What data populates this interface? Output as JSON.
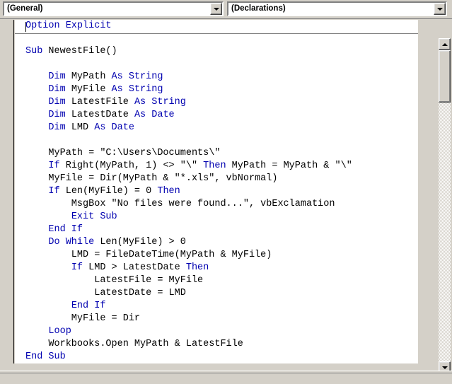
{
  "window": {
    "kind": "vba-code-editor"
  },
  "toolbar": {
    "object_combo": {
      "name": "object-combo",
      "value": "(General)",
      "arrow_icon": "chevron-down-icon"
    },
    "procedure_combo": {
      "name": "procedure-combo",
      "value": "(Declarations)",
      "arrow_icon": "chevron-down-icon"
    }
  },
  "editor": {
    "lines": [
      [
        {
          "t": "Option Explicit",
          "c": "kw"
        }
      ],
      [],
      [
        {
          "t": "Sub ",
          "c": "kw"
        },
        {
          "t": "NewestFile()",
          "c": "pl"
        }
      ],
      [],
      [
        {
          "t": "    ",
          "c": "pl"
        },
        {
          "t": "Dim ",
          "c": "kw"
        },
        {
          "t": "MyPath ",
          "c": "pl"
        },
        {
          "t": "As String",
          "c": "kw"
        }
      ],
      [
        {
          "t": "    ",
          "c": "pl"
        },
        {
          "t": "Dim ",
          "c": "kw"
        },
        {
          "t": "MyFile ",
          "c": "pl"
        },
        {
          "t": "As String",
          "c": "kw"
        }
      ],
      [
        {
          "t": "    ",
          "c": "pl"
        },
        {
          "t": "Dim ",
          "c": "kw"
        },
        {
          "t": "LatestFile ",
          "c": "pl"
        },
        {
          "t": "As String",
          "c": "kw"
        }
      ],
      [
        {
          "t": "    ",
          "c": "pl"
        },
        {
          "t": "Dim ",
          "c": "kw"
        },
        {
          "t": "LatestDate ",
          "c": "pl"
        },
        {
          "t": "As Date",
          "c": "kw"
        }
      ],
      [
        {
          "t": "    ",
          "c": "pl"
        },
        {
          "t": "Dim ",
          "c": "kw"
        },
        {
          "t": "LMD ",
          "c": "pl"
        },
        {
          "t": "As Date",
          "c": "kw"
        }
      ],
      [],
      [
        {
          "t": "    MyPath = \"C:\\Users\\Documents\\\"",
          "c": "pl"
        }
      ],
      [
        {
          "t": "    ",
          "c": "pl"
        },
        {
          "t": "If ",
          "c": "kw"
        },
        {
          "t": "Right(MyPath, 1) <> \"\\\" ",
          "c": "pl"
        },
        {
          "t": "Then ",
          "c": "kw"
        },
        {
          "t": "MyPath = MyPath & \"\\\"",
          "c": "pl"
        }
      ],
      [
        {
          "t": "    MyFile = Dir(MyPath & \"*.xls\", vbNormal)",
          "c": "pl"
        }
      ],
      [
        {
          "t": "    ",
          "c": "pl"
        },
        {
          "t": "If ",
          "c": "kw"
        },
        {
          "t": "Len(MyFile) = 0 ",
          "c": "pl"
        },
        {
          "t": "Then",
          "c": "kw"
        }
      ],
      [
        {
          "t": "        MsgBox \"No files were found...\", vbExclamation",
          "c": "pl"
        }
      ],
      [
        {
          "t": "        ",
          "c": "pl"
        },
        {
          "t": "Exit Sub",
          "c": "kw"
        }
      ],
      [
        {
          "t": "    ",
          "c": "pl"
        },
        {
          "t": "End If",
          "c": "kw"
        }
      ],
      [
        {
          "t": "    ",
          "c": "pl"
        },
        {
          "t": "Do While ",
          "c": "kw"
        },
        {
          "t": "Len(MyFile) > 0",
          "c": "pl"
        }
      ],
      [
        {
          "t": "        LMD = FileDateTime(MyPath & MyFile)",
          "c": "pl"
        }
      ],
      [
        {
          "t": "        ",
          "c": "pl"
        },
        {
          "t": "If ",
          "c": "kw"
        },
        {
          "t": "LMD > LatestDate ",
          "c": "pl"
        },
        {
          "t": "Then",
          "c": "kw"
        }
      ],
      [
        {
          "t": "            LatestFile = MyFile",
          "c": "pl"
        }
      ],
      [
        {
          "t": "            LatestDate = LMD",
          "c": "pl"
        }
      ],
      [
        {
          "t": "        ",
          "c": "pl"
        },
        {
          "t": "End If",
          "c": "kw"
        }
      ],
      [
        {
          "t": "        MyFile = Dir",
          "c": "pl"
        }
      ],
      [
        {
          "t": "    ",
          "c": "pl"
        },
        {
          "t": "Loop",
          "c": "kw"
        }
      ],
      [
        {
          "t": "    Workbooks.Open MyPath & LatestFile",
          "c": "pl"
        }
      ],
      [
        {
          "t": "",
          "c": "pl"
        },
        {
          "t": "End Sub",
          "c": "kw"
        }
      ]
    ],
    "colors": {
      "keyword": "#0000b0",
      "plain": "#000000",
      "background": "#ffffff"
    }
  },
  "scrollbars": {
    "vertical": {
      "up_icon": "scroll-up-arrow-icon",
      "down_icon": "scroll-down-arrow-icon"
    },
    "horizontal": {
      "left_icon": "scroll-left-arrow-icon",
      "right_icon": "scroll-right-arrow-icon"
    }
  },
  "view_buttons": {
    "procedure_view": "procedure-view",
    "full_module_view": "full-module-view"
  }
}
